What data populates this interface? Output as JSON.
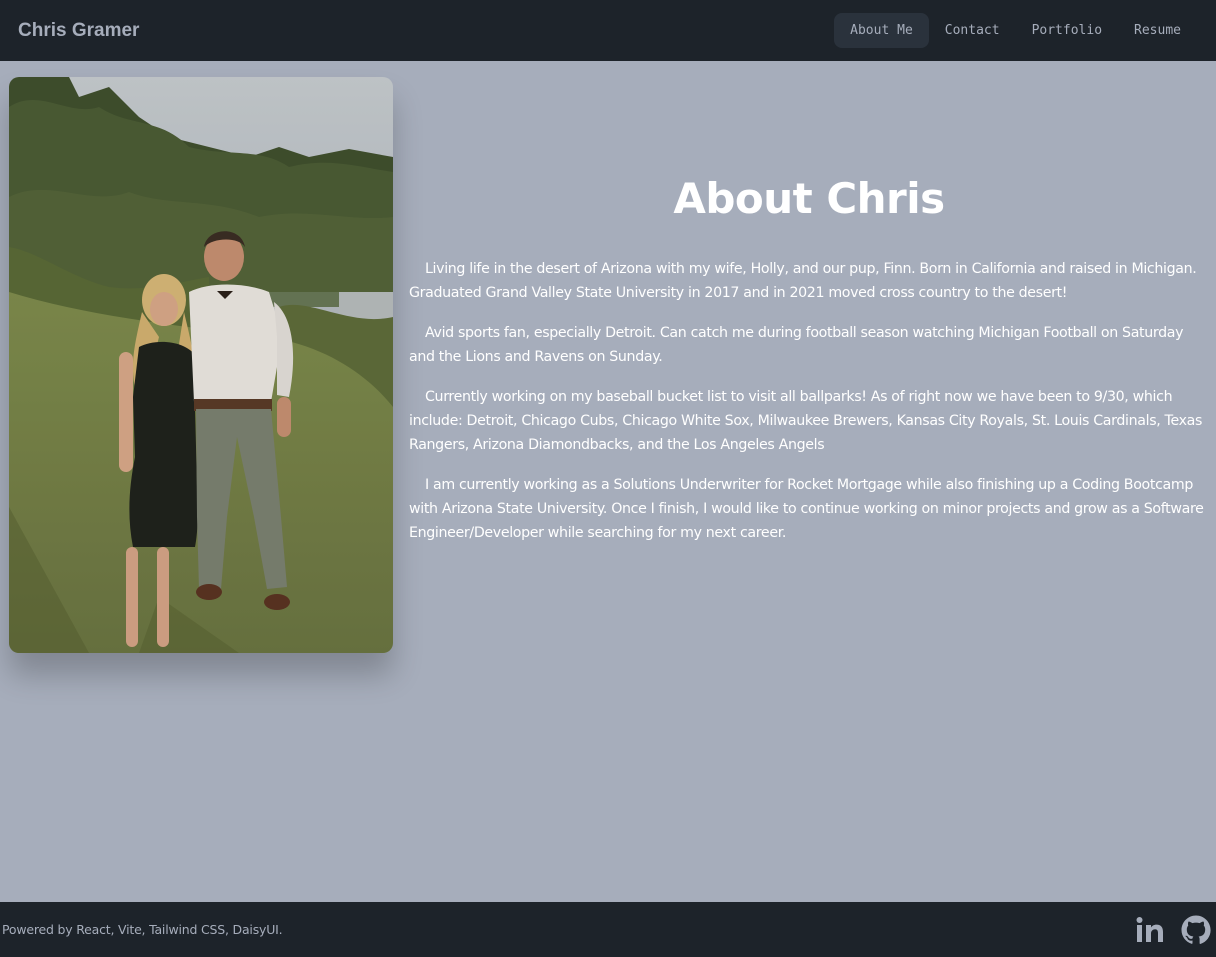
{
  "navbar": {
    "brand": "Chris Gramer",
    "links": [
      {
        "label": "About Me",
        "active": true
      },
      {
        "label": "Contact"
      },
      {
        "label": "Portfolio"
      },
      {
        "label": "Resume"
      }
    ]
  },
  "main": {
    "photo_icon": "couple-portrait-photo",
    "heading": "About Chris",
    "paragraphs": [
      "Living life in the desert of Arizona with my wife, Holly, and our pup, Finn. Born in California and raised in Michigan. Graduated Grand Valley State University in 2017 and in 2021 moved cross country to the desert!",
      "Avid sports fan, especially Detroit. Can catch me during football season watching Michigan Football on Saturday and the Lions and Ravens on Sunday.",
      "Currently working on my baseball bucket list to visit all ballparks! As of right now we have been to 9/30, which include: Detroit, Chicago Cubs, Chicago White Sox, Milwaukee Brewers, Kansas City Royals, St. Louis Cardinals, Texas Rangers, Arizona Diamondbacks, and the Los Angeles Angels",
      "I am currently working as a Solutions Underwriter for Rocket Mortgage while also finishing up a Coding Bootcamp with Arizona State University. Once I finish, I would like to continue working on minor projects and grow as a Software Engineer/Developer while searching for my next career."
    ]
  },
  "footer": {
    "text": "Powered by React, Vite, Tailwind CSS, DaisyUI.",
    "icons": [
      "linkedin-icon",
      "github-icon"
    ]
  },
  "colors": {
    "page_bg": "#a6adbb",
    "nav_bg": "#1d232a",
    "active_tab_bg": "#2a323c",
    "muted_text": "#a6adbb",
    "heading_text": "#ffffff"
  }
}
